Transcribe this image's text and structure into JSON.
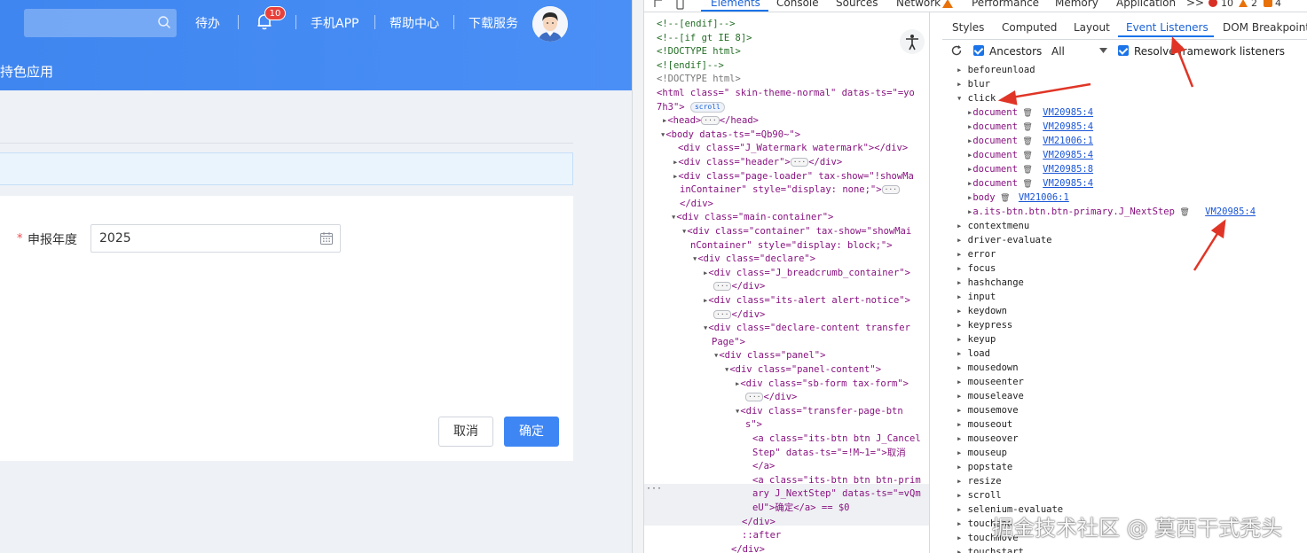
{
  "header": {
    "todo_label": "待办",
    "bell_badge": "10",
    "app_label": "手机APP",
    "help_label": "帮助中心",
    "download_label": "下载服务",
    "subtitle": "持色应用"
  },
  "form": {
    "required_mark": "*",
    "year_label": "申报年度",
    "year_value": "2025",
    "cancel_label": "取消",
    "ok_label": "确定"
  },
  "devtools": {
    "tabs": [
      "Elements",
      "Console",
      "Sources",
      "Network",
      "Performance",
      "Memory",
      "Application",
      ">>"
    ],
    "error_count": "10",
    "warning_count": "2",
    "info_count": "4",
    "side_tabs": [
      "Styles",
      "Computed",
      "Layout",
      "Event Listeners",
      "DOM Breakpoints"
    ],
    "ancestors_label": "Ancestors",
    "filter_value": "All",
    "resolve_label": "Resolve framework listeners",
    "elements_lines": [
      "<!--[endif]-->",
      "<!--[if gt IE 8]>",
      "<!DOCTYPE html>",
      "<![endif]-->",
      "<!DOCTYPE html>"
    ],
    "html_line": "<html class=\" skin-theme-normal\" datas-ts=\"=yo",
    "html_line2": "7h3\">",
    "scroll_pill": "scroll",
    "head_line": "<head>",
    "head_close": "</head>",
    "body_line": "<body datas-ts=\"=Qb90~\">",
    "watermark_div": "<div class=\"J_Watermark watermark\"></div>",
    "header_div": "<div class=\"header\">",
    "header_div_close": "</div>",
    "loader_line1": "<div class=\"page-loader\" tax-show=\"!showMa",
    "loader_line2": "inContainer\" style=\"display: none;\">",
    "loader_close": "</div>",
    "main_container": "<div class=\"main-container\">",
    "container_line1": "<div class=\"container\" tax-show=\"showMai",
    "container_line2": "nContainer\" style=\"display: block;\">",
    "declare_div": "<div class=\"declare\">",
    "breadcrumb_div": "<div class=\"J_breadcrumb_container\">",
    "breadcrumb_close": "</div>",
    "alert_div": "<div class=\"its-alert alert-notice\">",
    "alert_close": "</div>",
    "declare_content1": "<div class=\"declare-content transfer",
    "declare_content2": "Page\">",
    "panel_div": "<div class=\"panel\">",
    "panel_content_div": "<div class=\"panel-content\">",
    "sb_form_div": "<div class=\"sb-form tax-form\">",
    "sb_form_close": "</div>",
    "transfer_btns1": "<div class=\"transfer-page-btn",
    "transfer_btns2": "s\">",
    "cancel_a1": "<a class=\"its-btn btn J_Cancel",
    "cancel_a2": "Step\" datas-ts=\"=!M~1=\">取消",
    "cancel_a3": "</a>",
    "next_a1": "<a class=\"its-btn btn btn-prim",
    "next_a2": "ary J_NextStep\" datas-ts=\"=vQm",
    "next_a3": "eU\">确定</a> == $0",
    "div_close1": "</div>",
    "after_pseudo": "::after",
    "div_close2": "</div>",
    "gutter_dots": "···",
    "events": [
      {
        "name": "beforeunload",
        "expanded": false
      },
      {
        "name": "blur",
        "expanded": false
      },
      {
        "name": "click",
        "expanded": true
      },
      {
        "name": "contextmenu",
        "expanded": false
      },
      {
        "name": "driver-evaluate",
        "expanded": false
      },
      {
        "name": "error",
        "expanded": false
      },
      {
        "name": "focus",
        "expanded": false
      },
      {
        "name": "hashchange",
        "expanded": false
      },
      {
        "name": "input",
        "expanded": false
      },
      {
        "name": "keydown",
        "expanded": false
      },
      {
        "name": "keypress",
        "expanded": false
      },
      {
        "name": "keyup",
        "expanded": false
      },
      {
        "name": "load",
        "expanded": false
      },
      {
        "name": "mousedown",
        "expanded": false
      },
      {
        "name": "mouseenter",
        "expanded": false
      },
      {
        "name": "mouseleave",
        "expanded": false
      },
      {
        "name": "mousemove",
        "expanded": false
      },
      {
        "name": "mouseout",
        "expanded": false
      },
      {
        "name": "mouseover",
        "expanded": false
      },
      {
        "name": "mouseup",
        "expanded": false
      },
      {
        "name": "popstate",
        "expanded": false
      },
      {
        "name": "resize",
        "expanded": false
      },
      {
        "name": "scroll",
        "expanded": false
      },
      {
        "name": "selenium-evaluate",
        "expanded": false
      },
      {
        "name": "touchend",
        "expanded": false
      },
      {
        "name": "touchmove",
        "expanded": false
      },
      {
        "name": "touchstart",
        "expanded": false
      }
    ],
    "click_listeners": [
      {
        "target": "document",
        "source": "VM20985:4"
      },
      {
        "target": "document",
        "source": "VM20985:4"
      },
      {
        "target": "document",
        "source": "VM21006:1"
      },
      {
        "target": "document",
        "source": "VM20985:4"
      },
      {
        "target": "document",
        "source": "VM20985:8"
      },
      {
        "target": "document",
        "source": "VM20985:4"
      },
      {
        "target": "body",
        "source": "VM21006:1"
      },
      {
        "target": "a.its-btn.btn.btn-primary.J_NextStep",
        "source": "VM20985:4"
      }
    ]
  },
  "watermark": "掘金技术社区 @ 莫西干式秃头",
  "colors": {
    "header_blue": "#3f86f0",
    "primary_button": "#3e86f4",
    "arrow_red": "#e03526",
    "devtools_active": "#1a73e8"
  }
}
